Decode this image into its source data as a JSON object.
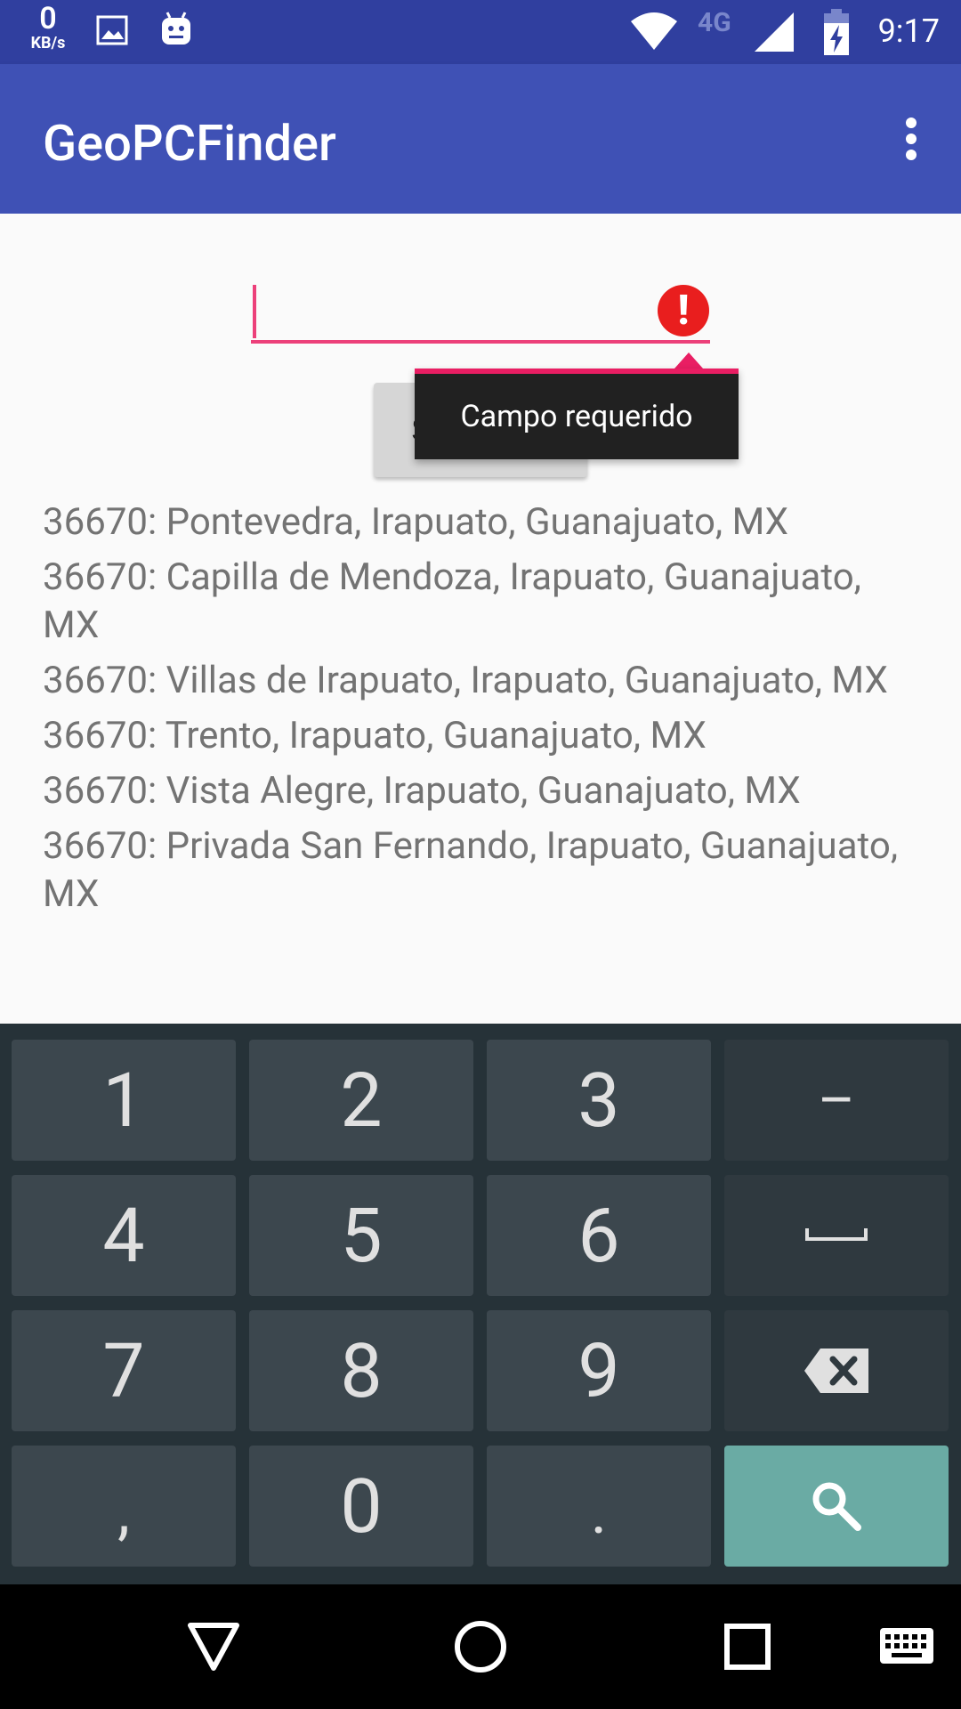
{
  "status_bar": {
    "net_speed_value": "0",
    "net_speed_unit": "KB/s",
    "network_type": "4G",
    "time": "9:17"
  },
  "toolbar": {
    "title": "GeoPCFinder"
  },
  "form": {
    "input_value": "",
    "error_message": "Campo requerido",
    "search_label": "SEARCH"
  },
  "results": [
    "36670: Pontevedra, Irapuato, Guanajuato, MX",
    "36670: Capilla de Mendoza, Irapuato, Guanajuato, MX",
    "36670: Villas de Irapuato, Irapuato, Guanajuato, MX",
    "36670: Trento, Irapuato, Guanajuato, MX",
    "36670: Vista Alegre, Irapuato, Guanajuato, MX",
    "36670: Privada San Fernando, Irapuato, Guanajuato, MX"
  ],
  "keyboard": {
    "keys": [
      "1",
      "2",
      "3",
      "–",
      "4",
      "5",
      "6",
      "␣",
      "7",
      "8",
      "9",
      "backspace",
      ",",
      "0",
      ".",
      "search"
    ]
  },
  "colors": {
    "status_bar": "#303f9f",
    "toolbar": "#3f51b5",
    "accent": "#ec407a",
    "error": "#e91e1e",
    "keyboard_bg": "#263238",
    "key_bg": "#3c474e",
    "search_key_bg": "#6aaba4"
  },
  "icons": {
    "status_left": [
      "image-icon",
      "android-icon"
    ],
    "status_right": [
      "wifi-icon",
      "signal-icon",
      "battery-charging-icon"
    ],
    "nav": [
      "back-icon",
      "home-icon",
      "recents-icon",
      "keyboard-switch-icon"
    ]
  }
}
